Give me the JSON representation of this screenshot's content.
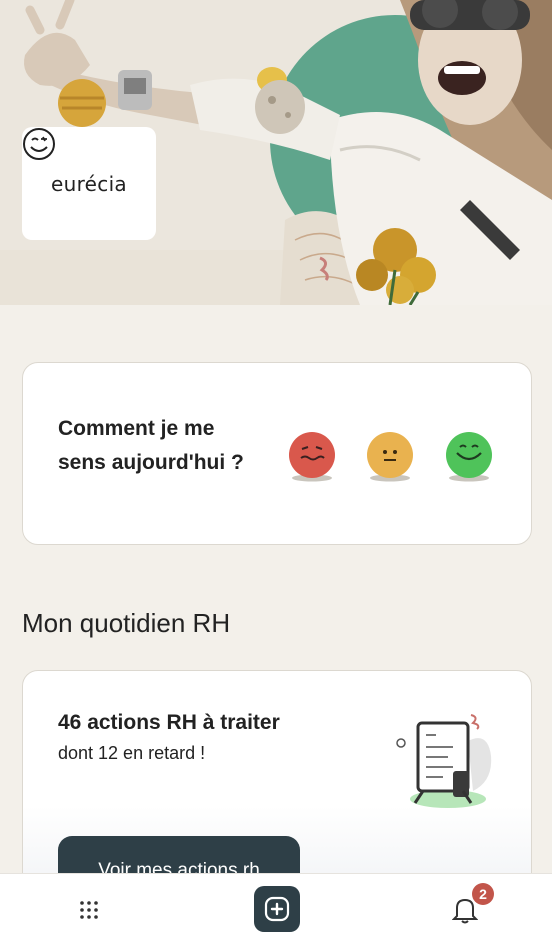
{
  "brand": {
    "logo_text": "eurécia"
  },
  "mood": {
    "question": "Comment je me sens aujourd'hui ?",
    "options": [
      {
        "name": "bad-mood",
        "color": "#d9584c"
      },
      {
        "name": "neutral-mood",
        "color": "#e9b24f"
      },
      {
        "name": "good-mood",
        "color": "#4fc35a"
      }
    ]
  },
  "section": {
    "title": "Mon quotidien RH"
  },
  "hr_actions": {
    "title": "46 actions RH à traiter",
    "subtitle": "dont 12 en retard !",
    "button_label": "Voir mes actions rh"
  },
  "nav": {
    "items": [
      "apps-grid-icon",
      "add-icon",
      "bell-icon"
    ],
    "notification_count": "2"
  },
  "colors": {
    "background": "#f3f0ea",
    "dark_button": "#2e3f47",
    "badge": "#c2554a"
  }
}
